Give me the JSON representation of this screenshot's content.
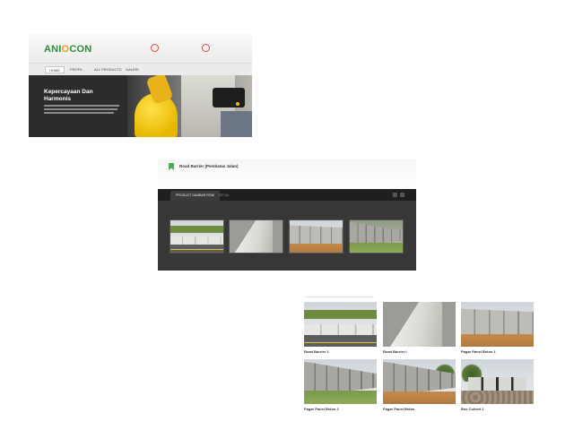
{
  "header": {
    "logo_text_main": "ANI",
    "logo_text_accent": "O",
    "logo_text_end": "CON",
    "logo_tagline": "",
    "contacts": [
      {
        "number": "",
        "sub": ""
      },
      {
        "number": "",
        "sub": ""
      }
    ]
  },
  "nav": {
    "items": [
      {
        "label": "HOME",
        "active": true
      },
      {
        "label": "PROFIL",
        "active": false
      },
      {
        "label": "ALL PRODUCTS",
        "active": false
      },
      {
        "label": "GALERI",
        "active": false
      }
    ]
  },
  "hero": {
    "title": "Kepercayaan Dan Harmonis",
    "colors": {
      "helmet": "#f2c300",
      "background": "#2c2c2c"
    }
  },
  "product_panel": {
    "title": "Road Barrier (Pembatas Jalan)",
    "tabs": [
      {
        "label": "PRODUCT GAMBAR ROW",
        "active": true
      },
      {
        "label": "DETAIL",
        "active": false
      }
    ],
    "gallery": [
      {
        "name": "road-barrier-thumb"
      },
      {
        "name": "jersey-barrier-thumb"
      },
      {
        "name": "panel-fence-thumb"
      },
      {
        "name": "panel-fence-green-thumb"
      }
    ]
  },
  "product_grid": {
    "items": [
      {
        "caption": "Road Barrier 2"
      },
      {
        "caption": "Road Barrier I"
      },
      {
        "caption": "Pagar Panel Beton 1"
      },
      {
        "caption": "Pagar Panel Beton 2"
      },
      {
        "caption": "Pagar Panel Beton"
      },
      {
        "caption": "Box Culvert 1"
      }
    ]
  },
  "colors": {
    "brand_green": "#2f8a3a",
    "brand_orange": "#e3a21a",
    "tab_bar": "#1f1f1f",
    "gallery_bg": "#373737",
    "bookmark": "#4caf50"
  }
}
